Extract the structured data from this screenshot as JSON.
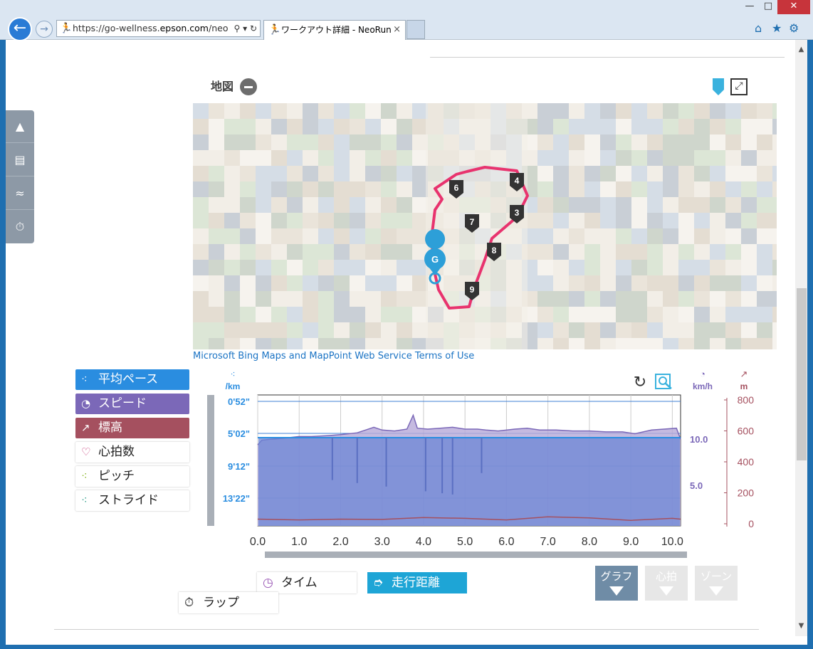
{
  "browser": {
    "url_prefix": "https://go-wellness.",
    "url_domain": "epson.com",
    "url_suffix": "/neo",
    "tab_title": "ワークアウト詳細 - NeoRun",
    "window_controls": {
      "minimize": "—",
      "maximize": "□",
      "close": "✕"
    },
    "tab_close": "×"
  },
  "map": {
    "title": "地図",
    "terms": "Microsoft Bing Maps and MapPoint Web Service Terms of Use",
    "goal_marker": "G",
    "lap_markers": [
      "3",
      "4",
      "6",
      "7",
      "8",
      "9"
    ],
    "route_color": "#e8336e"
  },
  "metrics": [
    {
      "label": "平均ペース",
      "icon": "footsteps-icon",
      "active": true,
      "color": "#2a8de0"
    },
    {
      "label": "スピード",
      "icon": "speedometer-icon",
      "active": true,
      "color": "#7b68b8"
    },
    {
      "label": "標高",
      "icon": "elevation-icon",
      "active": true,
      "color": "#a5505f"
    },
    {
      "label": "心拍数",
      "icon": "heart-icon",
      "active": false,
      "color": "#c63c7a"
    },
    {
      "label": "ピッチ",
      "icon": "pitch-icon",
      "active": false,
      "color": "#8db82a"
    },
    {
      "label": "ストライド",
      "icon": "stride-icon",
      "active": false,
      "color": "#3aa390"
    }
  ],
  "chart_data": {
    "type": "area",
    "x_ticks": [
      "0.0",
      "1.0",
      "2.0",
      "3.0",
      "4.0",
      "5.0",
      "6.0",
      "7.0",
      "8.0",
      "9.0",
      "10.0"
    ],
    "xlim": [
      0,
      10.2
    ],
    "pace_axis": {
      "unit": "/km",
      "ticks": [
        "0'52\"",
        "5'02\"",
        "9'12\"",
        "13'22\""
      ]
    },
    "speed_axis": {
      "unit": "km/h",
      "ticks": [
        "10.0",
        "5.0"
      ]
    },
    "elevation_axis": {
      "unit": "m",
      "ticks": [
        "800",
        "600",
        "400",
        "200",
        "0"
      ]
    },
    "speed_series": {
      "name": "スピード",
      "x": [
        0,
        0.1,
        0.3,
        0.6,
        1.0,
        1.3,
        1.7,
        2.0,
        2.4,
        2.8,
        3.0,
        3.3,
        3.6,
        3.75,
        3.85,
        4.1,
        4.4,
        4.7,
        5.0,
        5.3,
        5.5,
        5.8,
        6.2,
        6.5,
        6.8,
        7.2,
        7.6,
        8.0,
        8.4,
        8.8,
        9.1,
        9.5,
        9.8,
        10.1,
        10.2
      ],
      "y": [
        10.3,
        10.8,
        10.9,
        11.0,
        11.2,
        11.2,
        11.3,
        11.4,
        11.6,
        12.2,
        11.9,
        11.8,
        12.0,
        13.5,
        12.1,
        12.0,
        12.1,
        12.2,
        12.0,
        12.0,
        11.9,
        11.8,
        12.0,
        12.1,
        11.9,
        11.9,
        11.8,
        11.8,
        11.7,
        11.7,
        11.5,
        11.9,
        12.0,
        12.1,
        10.9
      ]
    },
    "pace_dips_km": [
      1.8,
      2.4,
      3.1,
      4.05,
      4.45,
      4.7,
      5.4
    ],
    "elevation_series": {
      "name": "標高",
      "x": [
        0,
        1,
        2,
        3,
        4,
        5,
        6,
        7,
        8,
        9,
        10,
        10.2
      ],
      "y": [
        30,
        25,
        30,
        28,
        40,
        35,
        25,
        45,
        38,
        22,
        35,
        30
      ]
    },
    "grid": true
  },
  "controls": {
    "time_label": "タイム",
    "distance_label": "走行距離",
    "lap_label": "ラップ",
    "graph_tab": "グラフ",
    "hr_tab": "心拍",
    "zone_tab": "ゾーン"
  },
  "colors": {
    "pace": "#2a8de0",
    "speed": "#7b68b8",
    "elevation": "#a5505f",
    "distance_btn": "#1ea5d6",
    "graph_tab": "#6f8ca6",
    "inactive_tab": "#e7e7e7"
  }
}
